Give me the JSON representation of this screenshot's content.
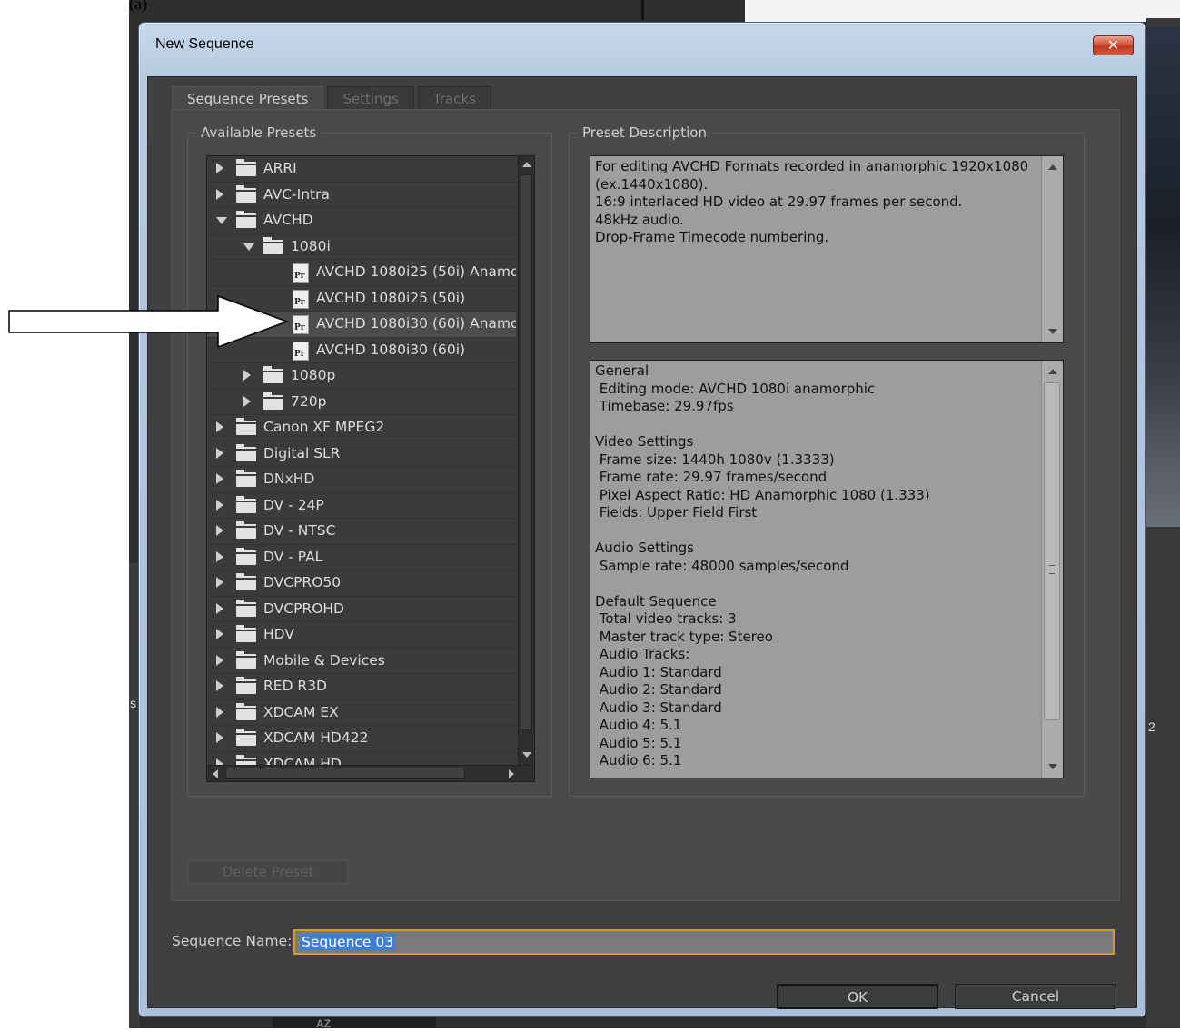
{
  "background": {
    "top_text": "(a) ",
    "right_number": "2",
    "left_letter": "s",
    "bottom_tab_label": "AZ"
  },
  "dialog": {
    "title": "New Sequence",
    "close_glyph": "✕",
    "tabs": [
      "Sequence Presets",
      "Settings",
      "Tracks"
    ],
    "available_presets_label": "Available Presets",
    "preset_description_label": "Preset Description",
    "tree": [
      {
        "type": "folder",
        "level": 0,
        "expanded": false,
        "label": "ARRI"
      },
      {
        "type": "folder",
        "level": 0,
        "expanded": false,
        "label": "AVC-Intra"
      },
      {
        "type": "folder",
        "level": 0,
        "expanded": true,
        "label": "AVCHD"
      },
      {
        "type": "folder",
        "level": 1,
        "expanded": true,
        "label": "1080i"
      },
      {
        "type": "preset",
        "level": 2,
        "label": "AVCHD 1080i25 (50i) Anamo"
      },
      {
        "type": "preset",
        "level": 2,
        "label": "AVCHD 1080i25 (50i)"
      },
      {
        "type": "preset",
        "level": 2,
        "label": "AVCHD 1080i30 (60i) Anamo",
        "selected": true
      },
      {
        "type": "preset",
        "level": 2,
        "label": "AVCHD 1080i30 (60i)"
      },
      {
        "type": "folder",
        "level": 1,
        "expanded": false,
        "label": "1080p"
      },
      {
        "type": "folder",
        "level": 1,
        "expanded": false,
        "label": "720p"
      },
      {
        "type": "folder",
        "level": 0,
        "expanded": false,
        "label": "Canon XF MPEG2"
      },
      {
        "type": "folder",
        "level": 0,
        "expanded": false,
        "label": "Digital SLR"
      },
      {
        "type": "folder",
        "level": 0,
        "expanded": false,
        "label": "DNxHD"
      },
      {
        "type": "folder",
        "level": 0,
        "expanded": false,
        "label": "DV - 24P"
      },
      {
        "type": "folder",
        "level": 0,
        "expanded": false,
        "label": "DV - NTSC"
      },
      {
        "type": "folder",
        "level": 0,
        "expanded": false,
        "label": "DV - PAL"
      },
      {
        "type": "folder",
        "level": 0,
        "expanded": false,
        "label": "DVCPRO50"
      },
      {
        "type": "folder",
        "level": 0,
        "expanded": false,
        "label": "DVCPROHD"
      },
      {
        "type": "folder",
        "level": 0,
        "expanded": false,
        "label": "HDV"
      },
      {
        "type": "folder",
        "level": 0,
        "expanded": false,
        "label": "Mobile & Devices"
      },
      {
        "type": "folder",
        "level": 0,
        "expanded": false,
        "label": "RED R3D"
      },
      {
        "type": "folder",
        "level": 0,
        "expanded": false,
        "label": "XDCAM EX"
      },
      {
        "type": "folder",
        "level": 0,
        "expanded": false,
        "label": "XDCAM HD422"
      },
      {
        "type": "folder",
        "level": 0,
        "expanded": false,
        "label": "XDCAM HD"
      }
    ],
    "preset_icon_text": "Pr",
    "description": "For editing AVCHD Formats recorded in anamorphic 1920x1080\n(ex.1440x1080).\n16:9 interlaced HD video at 29.97 frames per second.\n48kHz audio.\nDrop-Frame Timecode numbering.",
    "general_info": "General\n Editing mode: AVCHD 1080i anamorphic\n Timebase: 29.97fps\n\nVideo Settings\n Frame size: 1440h 1080v (1.3333)\n Frame rate: 29.97 frames/second\n Pixel Aspect Ratio: HD Anamorphic 1080 (1.333)\n Fields: Upper Field First\n\nAudio Settings\n Sample rate: 48000 samples/second\n\nDefault Sequence\n Total video tracks: 3\n Master track type: Stereo\n Audio Tracks:\n Audio 1: Standard\n Audio 2: Standard\n Audio 3: Standard\n Audio 4: 5.1\n Audio 5: 5.1\n Audio 6: 5.1",
    "delete_preset_label": "Delete Preset",
    "sequence_name_label": "Sequence Name:",
    "sequence_name_value": "Sequence 03",
    "ok_label": "OK",
    "cancel_label": "Cancel"
  },
  "colors": {
    "dialog_bg": "#404040",
    "panel_bg": "#4a4a4a",
    "description_bg": "#9d9d9d",
    "selection_highlight": "#3e7fd6",
    "input_focus_border": "#d49a2a"
  }
}
